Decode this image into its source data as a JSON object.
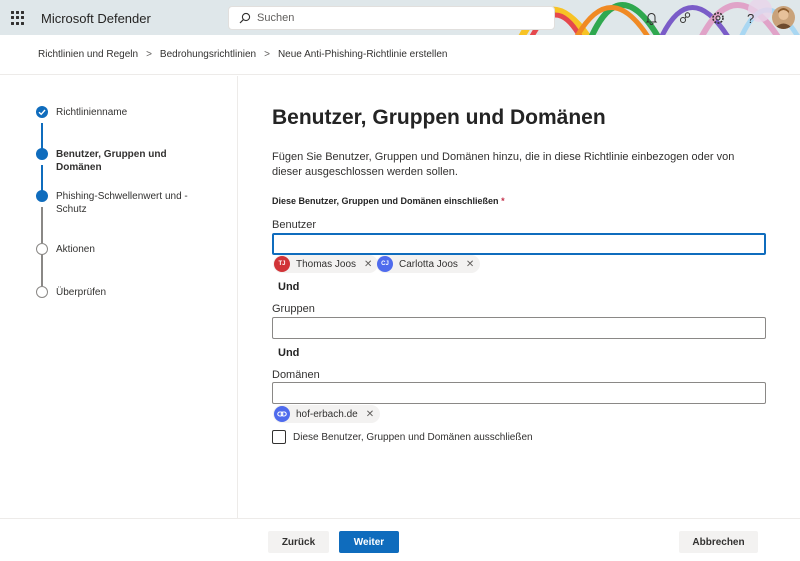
{
  "app": {
    "title": "Microsoft Defender",
    "search_placeholder": "Suchen",
    "icons": [
      "waffle-icon",
      "bell-icon",
      "community-icon",
      "gear-icon",
      "help-icon"
    ]
  },
  "breadcrumb": {
    "items": [
      "Richtlinien und Regeln",
      "Bedrohungsrichtlinien",
      "Neue Anti-Phishing-Richtlinie erstellen"
    ],
    "separator": ">"
  },
  "steps": [
    {
      "label": "Richtlinienname",
      "state": "done"
    },
    {
      "label": "Benutzer, Gruppen und Domänen",
      "state": "active"
    },
    {
      "label": "Phishing-Schwellenwert und -Schutz",
      "state": "active"
    },
    {
      "label": "Aktionen",
      "state": "pending"
    },
    {
      "label": "Überprüfen",
      "state": "pending"
    }
  ],
  "main": {
    "title": "Benutzer, Gruppen und Domänen",
    "description": "Fügen Sie Benutzer, Gruppen und Domänen hinzu, die in diese Richtlinie einbezogen oder von dieser ausgeschlossen werden sollen.",
    "include_label": "Diese Benutzer, Gruppen und Domänen einschließen",
    "required_mark": "*",
    "users_label": "Benutzer",
    "users_value": "",
    "users": [
      {
        "initials": "TJ",
        "name": "Thomas Joos",
        "color": "#d13438"
      },
      {
        "initials": "CJ",
        "name": "Carlotta Joos",
        "color": "#4f6bed"
      }
    ],
    "and_1": "Und",
    "groups_label": "Gruppen",
    "groups_value": "",
    "and_2": "Und",
    "domains_label": "Domänen",
    "domains_value": "",
    "domains": [
      {
        "name": "hof-erbach.de",
        "color": "#4f6bed",
        "icon": "link-icon"
      }
    ],
    "exclude_label": "Diese Benutzer, Gruppen und Domänen ausschließen",
    "exclude_checked": false
  },
  "footer": {
    "back": "Zurück",
    "next": "Weiter",
    "cancel": "Abbrechen"
  },
  "colors": {
    "accent": "#0f6cbd",
    "required": "#c4314b"
  }
}
